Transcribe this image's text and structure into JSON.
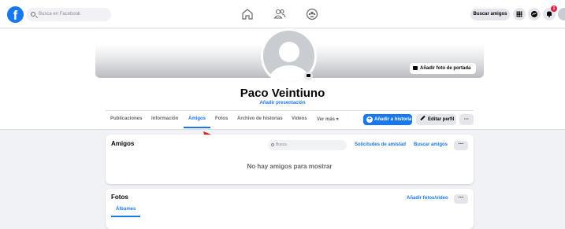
{
  "topbar": {
    "search_placeholder": "Busca en Facebook",
    "find_friends_label": "Buscar amigos",
    "notification_count": "1"
  },
  "profile": {
    "name": "Paco Veintiuno",
    "bio_link": "Añadir presentación",
    "cover_button": "Añadir foto de portada"
  },
  "tabs": [
    {
      "label": "Publicaciones"
    },
    {
      "label": "Información"
    },
    {
      "label": "Amigos",
      "active": true
    },
    {
      "label": "Fotos"
    },
    {
      "label": "Archivo de historias"
    },
    {
      "label": "Videos"
    },
    {
      "label": "Ver más ▾"
    }
  ],
  "actions": {
    "add_story": "Añadir a historia",
    "edit_profile": "Editar perfil",
    "more": "···"
  },
  "friends_card": {
    "title": "Amigos",
    "search_placeholder": "Busca",
    "requests_link": "Solicitudes de amistad",
    "find_link": "Buscar amigos",
    "more": "···",
    "empty_message": "No hay amigos para mostrar"
  },
  "photos_card": {
    "title": "Fotos",
    "add_link": "Añadir fotos/video",
    "more": "···",
    "subtab": "Álbumes"
  },
  "colors": {
    "accent": "#1877f2",
    "background": "#f0f2f5",
    "pointer_arrow": "#e41e1e"
  }
}
